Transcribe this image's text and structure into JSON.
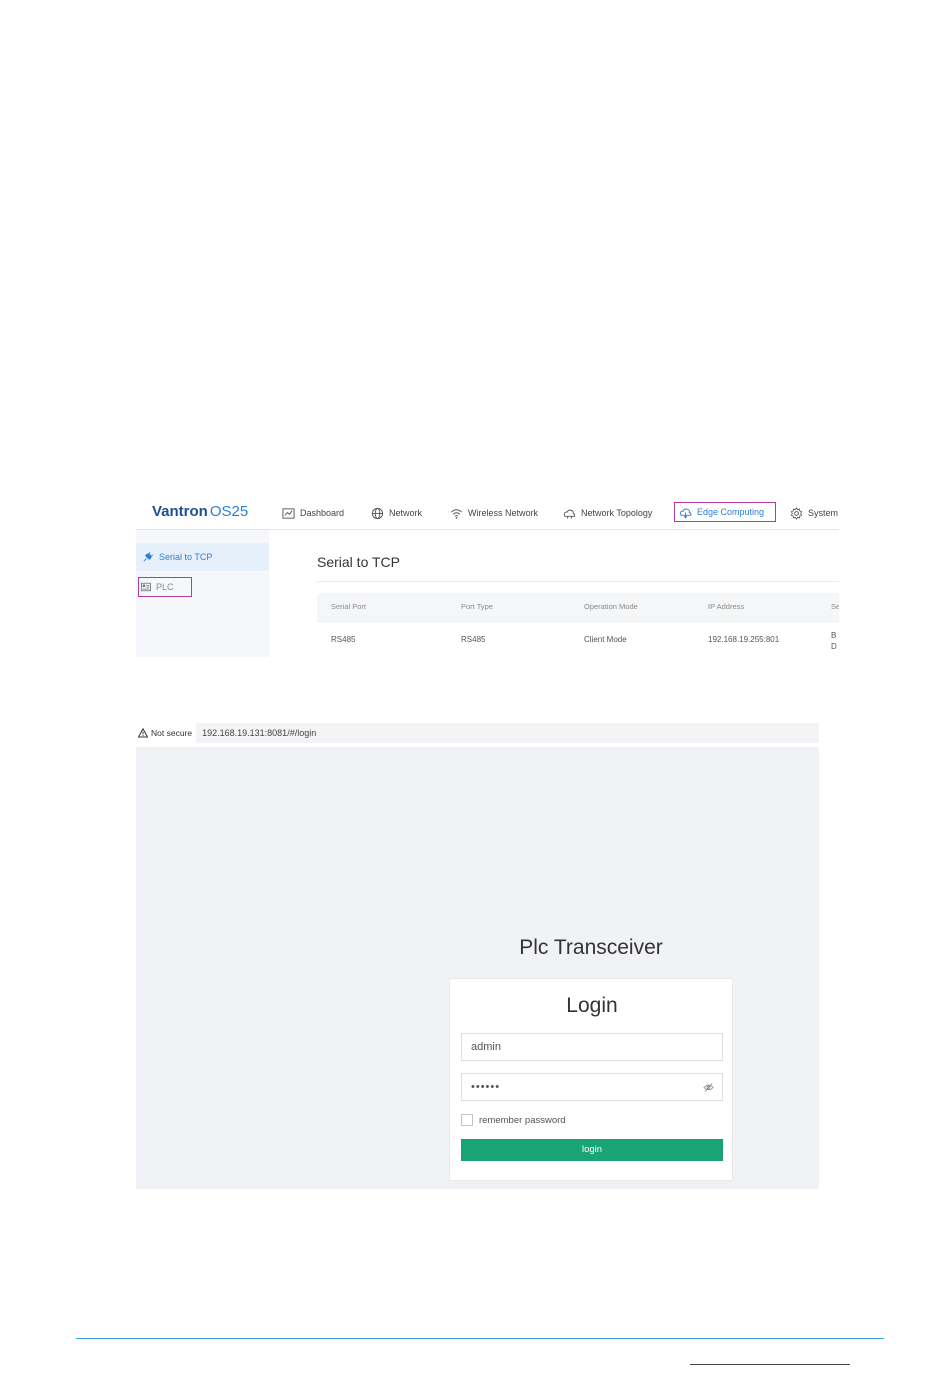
{
  "os_app": {
    "brand": "Vantron",
    "brand_version": "OS25",
    "nav": [
      {
        "label": "Dashboard",
        "icon": "chart-icon"
      },
      {
        "label": "Network",
        "icon": "globe-icon"
      },
      {
        "label": "Wireless Network",
        "icon": "wifi-icon"
      },
      {
        "label": "Network Topology",
        "icon": "topology-icon"
      },
      {
        "label": "Edge Computing",
        "icon": "cloud-icon",
        "active": true
      },
      {
        "label": "System",
        "icon": "gear-icon"
      }
    ],
    "sidebar": [
      {
        "label": "Serial to TCP",
        "icon": "plug-icon",
        "active": true
      },
      {
        "label": "PLC",
        "icon": "plc-icon"
      }
    ],
    "content_title": "Serial to TCP",
    "table": {
      "columns": [
        "Serial Port",
        "Port Type",
        "Operation Mode",
        "IP Address",
        "Se"
      ],
      "rows": [
        [
          "RS485",
          "RS485",
          "Client Mode",
          "192.168.19.255:801",
          "B\nD"
        ]
      ]
    },
    "colors": {
      "accent": "#2f7fd1",
      "highlight_box": "#b23aa6"
    }
  },
  "browser": {
    "security_label": "Not secure",
    "url": "192.168.19.131:8081/#/login"
  },
  "login": {
    "app_title": "Plc Transceiver",
    "heading": "Login",
    "username_value": "admin",
    "password_value": "••••••",
    "remember_label": "remember password",
    "button_label": "login",
    "colors": {
      "button": "#1aa474"
    }
  }
}
